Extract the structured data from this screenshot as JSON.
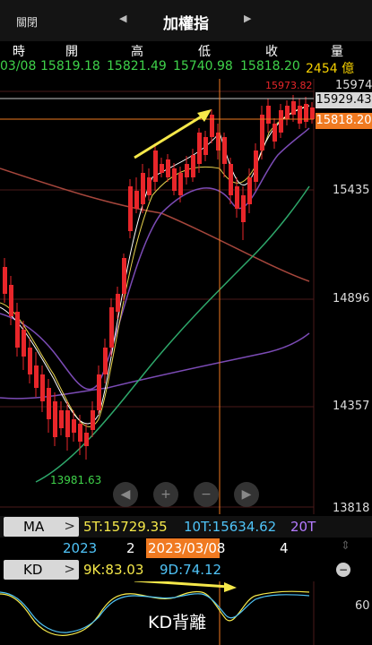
{
  "header": {
    "close_label": "關閉",
    "prev_icon": "◀",
    "next_icon": "▶",
    "title": "加權指"
  },
  "quote": {
    "headers": [
      "時",
      "開",
      "高",
      "低",
      "收",
      "量"
    ],
    "date": "03/08",
    "open": "15819.18",
    "high": "15821.49",
    "low": "15740.98",
    "close": "15818.20",
    "volume": "2454 億"
  },
  "chart": {
    "y_labels": [
      "15974",
      "15435",
      "14896",
      "14357",
      "13818"
    ],
    "high_marker": "15973.82",
    "crosshair_value": "15929.43",
    "close_value": "15818.20",
    "low_marker": "13981.63",
    "controls": [
      "◀",
      "+",
      "−",
      "▶"
    ]
  },
  "ma": {
    "label": "MA",
    "arrow": ">",
    "ma5": "5T:15729.35",
    "ma10": "10T:15634.62",
    "ma20": "20T"
  },
  "timeline": {
    "year": "2023",
    "month_a": "2",
    "selected_date": "2023/03/08",
    "month_b": "4"
  },
  "kd": {
    "label": "KD",
    "arrow": ">",
    "k": "9K:83.03",
    "d": "9D:74.12",
    "annotation": "KD背離",
    "y_label": "60"
  },
  "colors": {
    "up": "#e8262a",
    "down": "#2ecc40",
    "ma_white": "#ffffff",
    "ma_yellow": "#e8d44d",
    "ma_purple": "#7b4bb5",
    "ma_green": "#2ea86b",
    "ma_brown": "#a5463c",
    "highlight": "#f07a21",
    "arrow": "#f5e84a"
  }
}
